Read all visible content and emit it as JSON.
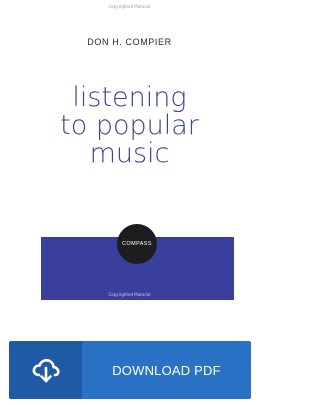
{
  "cover": {
    "copyright_top": "Copyrighted Material",
    "author": "DON H. COMPIER",
    "title_lines": [
      "listening",
      "to popular",
      "music"
    ],
    "publisher_logo": "COMPASS",
    "copyright_bottom": "Copyrighted Material"
  },
  "download": {
    "label": "DOWNLOAD PDF",
    "icon": "cloud-download-icon"
  },
  "colors": {
    "title": "#3b4497",
    "band": "#3a3f9e",
    "button_dark": "#1f5aa6",
    "button_light": "#2a72c5"
  }
}
